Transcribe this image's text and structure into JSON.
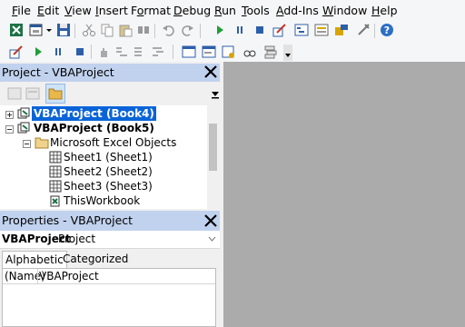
{
  "menu": [
    {
      "label": "File",
      "u": "F"
    },
    {
      "label": "Edit",
      "u": "E"
    },
    {
      "label": "View",
      "u": "V"
    },
    {
      "label": "Insert",
      "u": "I"
    },
    {
      "label": "Format",
      "u": "o"
    },
    {
      "label": "Debug",
      "u": "D"
    },
    {
      "label": "Run",
      "u": "R"
    },
    {
      "label": "Tools",
      "u": "T"
    },
    {
      "label": "Add-Ins",
      "u": "A"
    },
    {
      "label": "Window",
      "u": "W"
    },
    {
      "label": "Help",
      "u": "H"
    }
  ],
  "project_pane": {
    "title": "Project - VBAProject",
    "tree": [
      {
        "label": "VBAProject (Book4)",
        "selected": true,
        "bold": true
      },
      {
        "label": "VBAProject (Book5)",
        "bold": true
      },
      {
        "label": "Microsoft Excel Objects"
      },
      {
        "label": "Sheet1 (Sheet1)"
      },
      {
        "label": "Sheet2 (Sheet2)"
      },
      {
        "label": "Sheet3 (Sheet3)"
      },
      {
        "label": "ThisWorkbook"
      }
    ]
  },
  "properties_pane": {
    "title": "Properties - VBAProject",
    "object_name": "VBAProject",
    "object_type": "Project",
    "tabs": [
      "Alphabetic",
      "Categorized"
    ],
    "active_tab": "Alphabetic",
    "rows": [
      {
        "name": "(Name)",
        "value": "VBAProject"
      }
    ]
  },
  "colors": {
    "selection": "#0a64d8",
    "pane_title": "#c1d2ee",
    "workspace": "#ababab"
  },
  "icons": {
    "toolbar1": [
      "excel-view-icon",
      "insert-userform-icon",
      "dropdown-arrow-icon",
      "save-icon",
      "cut-icon",
      "copy-icon",
      "paste-icon",
      "find-icon",
      "undo-icon",
      "redo-icon",
      "run-icon",
      "break-icon",
      "reset-icon",
      "design-mode-icon",
      "project-explorer-icon",
      "properties-window-icon",
      "object-browser-icon",
      "toolbox-icon",
      "help-icon"
    ],
    "toolbar2": [
      "design-mode-icon",
      "run-icon",
      "break-icon",
      "reset-icon",
      "toggle-breakpoint-icon",
      "step-into-icon",
      "step-over-icon",
      "step-out-icon",
      "locals-icon",
      "immediate-icon",
      "watch-icon",
      "quick-watch-icon",
      "call-stack-icon",
      "toolbar-options-icon"
    ]
  }
}
